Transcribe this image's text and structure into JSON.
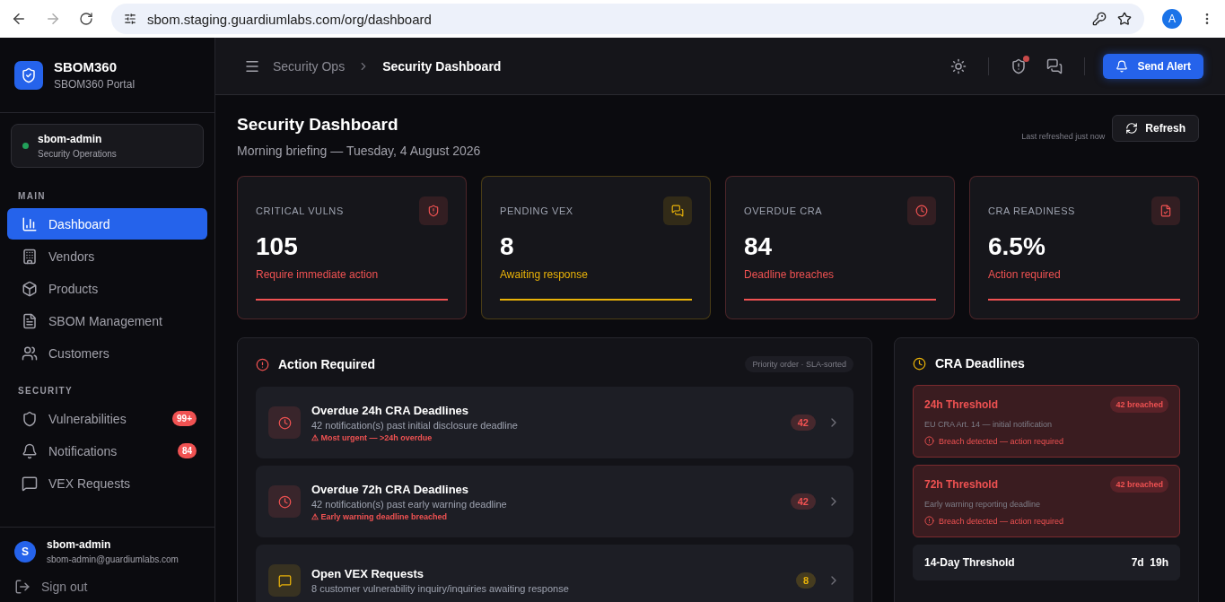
{
  "browser": {
    "url": "sbom.staging.guardiumlabs.com/org/dashboard",
    "profile": "A"
  },
  "brand": {
    "name": "SBOM360",
    "subtitle": "SBOM360 Portal"
  },
  "workspace": {
    "name": "sbom-admin",
    "role": "Security Operations",
    "online": true
  },
  "nav_sections": [
    {
      "title": "MAIN",
      "items": [
        {
          "label": "Dashboard",
          "selected": true
        },
        {
          "label": "Vendors",
          "selected": false
        },
        {
          "label": "Products",
          "selected": false
        },
        {
          "label": "SBOM Management",
          "selected": false
        },
        {
          "label": "Customers",
          "selected": false
        }
      ]
    },
    {
      "title": "SECURITY",
      "items": [
        {
          "label": "Vulnerabilities",
          "selected": false,
          "badge": "99+"
        },
        {
          "label": "Notifications",
          "selected": false,
          "badge": "84"
        },
        {
          "label": "VEX Requests",
          "selected": false
        }
      ]
    }
  ],
  "user": {
    "initial": "S",
    "name": "sbom-admin",
    "email": "sbom-admin@guardiumlabs.com"
  },
  "sign_out": "Sign out",
  "breadcrumb": [
    "Security Ops",
    "Security Dashboard"
  ],
  "header": {
    "alert_dot": true,
    "send_alert": "Send Alert"
  },
  "page": {
    "title": "Security Dashboard",
    "subtitle": "Morning briefing — Tuesday, 4 August 2026",
    "refreshed": "Last refreshed just now",
    "refresh": "Refresh"
  },
  "stats": [
    {
      "label": "CRITICAL VULNS",
      "value": "105",
      "note": "Require immediate action",
      "color": "#f05252"
    },
    {
      "label": "PENDING VEX",
      "value": "8",
      "note": "Awaiting response",
      "color": "#eab308"
    },
    {
      "label": "OVERDUE CRA",
      "value": "84",
      "note": "Deadline breaches",
      "color": "#f05252"
    },
    {
      "label": "CRA READINESS",
      "value": "6.5%",
      "note": "Action required",
      "color": "#f05252"
    }
  ],
  "action_required": {
    "title": "Action Required",
    "tag": "Priority order · SLA-sorted",
    "items": [
      {
        "title": "Overdue 24h CRA Deadlines",
        "detail": "42 notification(s) past initial disclosure deadline",
        "warning": "⚠ Most urgent — >24h overdue",
        "count": "42",
        "kind": "deadline"
      },
      {
        "title": "Overdue 72h CRA Deadlines",
        "detail": "42 notification(s) past early warning deadline",
        "warning": "⚠ Early warning deadline breached",
        "count": "42",
        "kind": "deadline"
      },
      {
        "title": "Open VEX Requests",
        "detail": "8 customer vulnerability inquiry/inquiries awaiting response",
        "count": "8",
        "kind": "vex"
      }
    ]
  },
  "cra_deadlines": {
    "title": "CRA Deadlines",
    "items": [
      {
        "title": "24h Threshold",
        "badge": "42 breached",
        "detail": "EU CRA Art. 14 — initial notification",
        "status": "Breach detected — action required",
        "breached": true
      },
      {
        "title": "72h Threshold",
        "badge": "42 breached",
        "detail": "Early warning reporting deadline",
        "status": "Breach detected — action required",
        "breached": true
      },
      {
        "title": "14-Day Threshold",
        "badge": "7d  19h",
        "breached": false
      }
    ]
  }
}
